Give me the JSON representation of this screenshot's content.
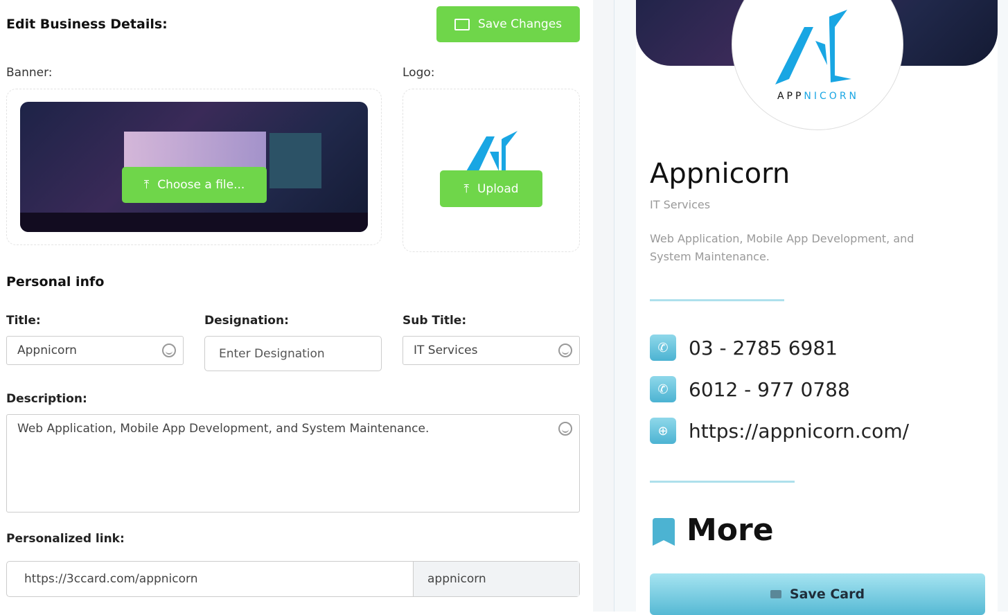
{
  "editor": {
    "heading": "Edit Business Details:",
    "save_changes": "Save Changes",
    "banner_label": "Banner:",
    "logo_label": "Logo:",
    "choose_file": "Choose a file...",
    "upload": "Upload",
    "personal_info": "Personal info",
    "title_label": "Title:",
    "title_value": "Appnicorn",
    "designation_label": "Designation:",
    "designation_placeholder": "Enter Designation",
    "subtitle_label": "Sub Title:",
    "subtitle_value": "IT Services",
    "description_label": "Description:",
    "description_value": "Web Application, Mobile App Development, and System Maintenance.",
    "link_label": "Personalized link:",
    "link_prefix": "https://3ccard.com/appnicorn",
    "link_slug": "appnicorn",
    "accent": "#6fd64a"
  },
  "preview": {
    "logo_text_a": "APP",
    "logo_text_b": "NICORN",
    "name": "Appnicorn",
    "subtitle": "IT Services",
    "description": "Web Application, Mobile App Development, and System Maintenance.",
    "contacts": [
      {
        "icon": "phone-icon",
        "text": "03 - 2785 6981"
      },
      {
        "icon": "whatsapp-icon",
        "text": "6012 - 977 0788"
      },
      {
        "icon": "globe-icon",
        "text": "https://appnicorn.com/"
      }
    ],
    "more": "More",
    "save_card": "Save Card",
    "accent": "#4cb3d2"
  }
}
